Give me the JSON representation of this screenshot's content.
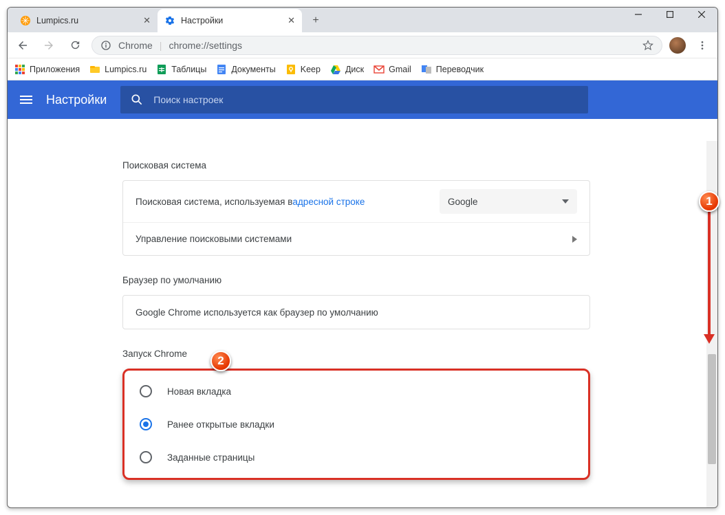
{
  "window": {
    "min": "—",
    "max": "▢",
    "close": "✕"
  },
  "tabs": [
    {
      "title": "Lumpics.ru",
      "active": false
    },
    {
      "title": "Настройки",
      "active": true
    }
  ],
  "toolbar": {
    "chrome_label": "Chrome",
    "url": "chrome://settings"
  },
  "bookmarks": [
    {
      "label": "Приложения"
    },
    {
      "label": "Lumpics.ru"
    },
    {
      "label": "Таблицы"
    },
    {
      "label": "Документы"
    },
    {
      "label": "Keep"
    },
    {
      "label": "Диск"
    },
    {
      "label": "Gmail"
    },
    {
      "label": "Переводчик"
    }
  ],
  "app": {
    "title": "Настройки",
    "search_placeholder": "Поиск настроек"
  },
  "sections": {
    "search_engine": {
      "title": "Поисковая система",
      "row1_prefix": "Поисковая система, используемая в ",
      "row1_link": "адресной строке",
      "row1_select": "Google",
      "row2": "Управление поисковыми системами"
    },
    "default_browser": {
      "title": "Браузер по умолчанию",
      "row1": "Google Chrome используется как браузер по умолчанию"
    },
    "startup": {
      "title": "Запуск Chrome",
      "options": [
        {
          "label": "Новая вкладка",
          "selected": false
        },
        {
          "label": "Ранее открытые вкладки",
          "selected": true
        },
        {
          "label": "Заданные страницы",
          "selected": false
        }
      ]
    }
  },
  "annotations": {
    "ball1": "1",
    "ball2": "2"
  }
}
